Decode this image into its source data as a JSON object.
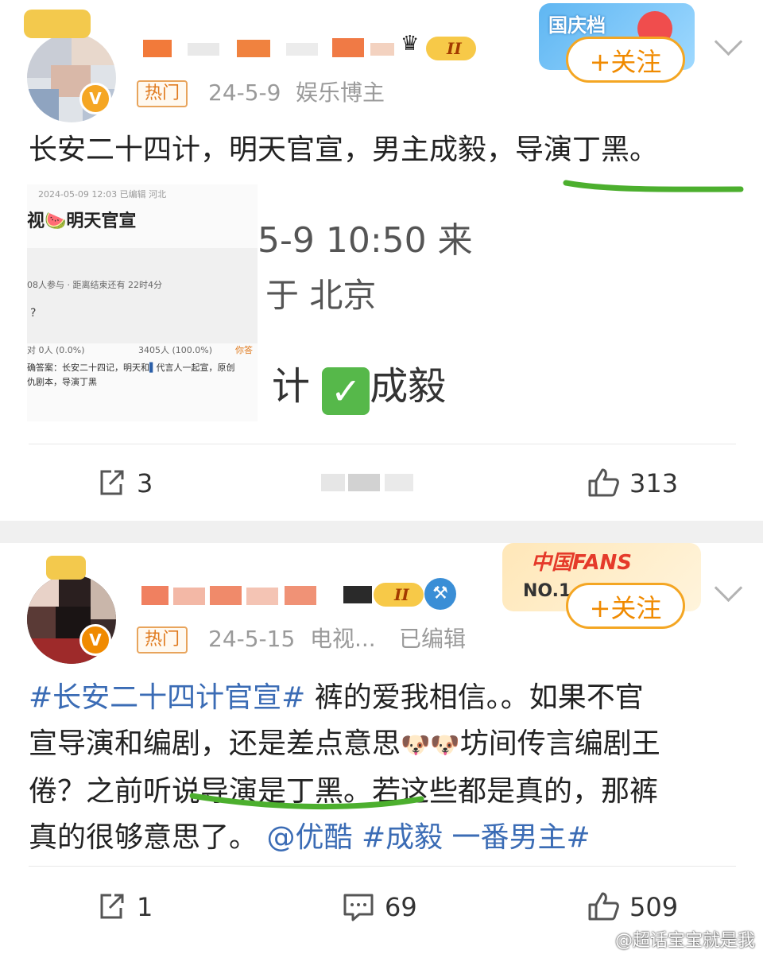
{
  "post1": {
    "hot_tag": "热门",
    "date": "24-5-9",
    "source": "娱乐博主",
    "level": "II",
    "badge_text": "国庆档",
    "follow_label": "+关注",
    "text": "长安二十四计，明天官宣，男主成毅，导演丁黑。",
    "screenshot": {
      "left_meta": "2024-05-09 12:03 已编辑 河北",
      "left_title": "视",
      "left_title_emoji": "🍉",
      "left_title_rest": "明天官宣",
      "vote_participants": "08人参与 · 距离结束还有 22时4分",
      "vote_question": "?",
      "vote_option_left": "对 0人 (0.0%)",
      "vote_option_right": "3405人 (100.0%)",
      "vote_option_answer": "你答",
      "answer_line1": "确答案：长安二十四记，明天和",
      "answer_line1b": "代言人一起宣，原创",
      "answer_line2": "仇剧本，导演丁黑",
      "right_line1": "5-9 10:50  来",
      "right_line2": "于 北京",
      "right_line3_a": "计",
      "right_line3_b": "成毅"
    },
    "actions": {
      "repost_count": "3",
      "like_count": "313"
    },
    "colors": {
      "accent": "#f08a00",
      "underline": "#4caf2e",
      "hashtag": "#3b6cb5"
    }
  },
  "post2": {
    "hot_tag": "热门",
    "date": "24-5-15",
    "source": "电视...",
    "edited": "已编辑",
    "level": "II",
    "badge_text_top": "中国FANS",
    "badge_text_bottom": "NO.1",
    "follow_label": "+关注",
    "line1_hashtag": "#长安二十四计官宣#",
    "line1_text": " 裤的爱我相信。。如果不官",
    "line2_text_a": "宣导演和编剧，还是差点意思",
    "line2_text_b": "坊间传言编剧王",
    "line3_text": "倦？之前听说导演是丁黑。若这些都是真的，那裤",
    "line4_text": "真的很够意思了。",
    "line4_mention": "@优酷",
    "line4_hashtag": "#成毅 一番男主#",
    "actions": {
      "repost_count": "1",
      "comment_count": "69",
      "like_count": "509"
    }
  },
  "watermark": "@超话宝宝就是我"
}
